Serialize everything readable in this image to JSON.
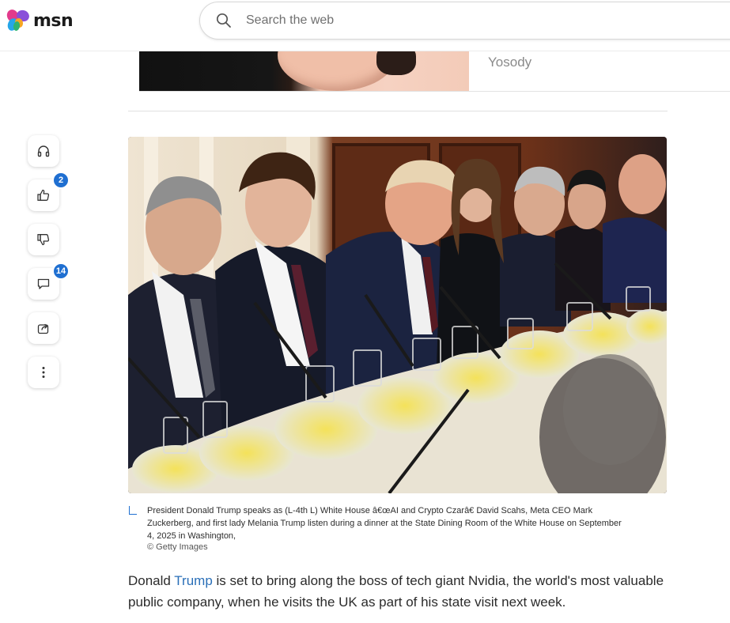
{
  "header": {
    "logo_text": "msn",
    "search_placeholder": "Search the web"
  },
  "previous_card": {
    "source": "Yosody"
  },
  "actions": {
    "like_count": "2",
    "comment_count": "14"
  },
  "article": {
    "caption": "President Donald Trump speaks as (L-4th L) White House â€œAI and Crypto Czarâ€ David Scahs, Meta CEO Mark Zuckerberg, and first lady Melania Trump listen during a dinner at the State Dining Room of the White House on September 4, 2025 in Washington,",
    "credit": "© Getty Images",
    "lead_before": "Donald ",
    "lead_link": "Trump",
    "lead_after": " is set to bring along the boss of tech giant Nvidia, the world's most valuable public company, when he visits the UK as part of his state visit next week."
  },
  "colors": {
    "accent": "#1f6fd1",
    "link": "#2a6fb8"
  }
}
